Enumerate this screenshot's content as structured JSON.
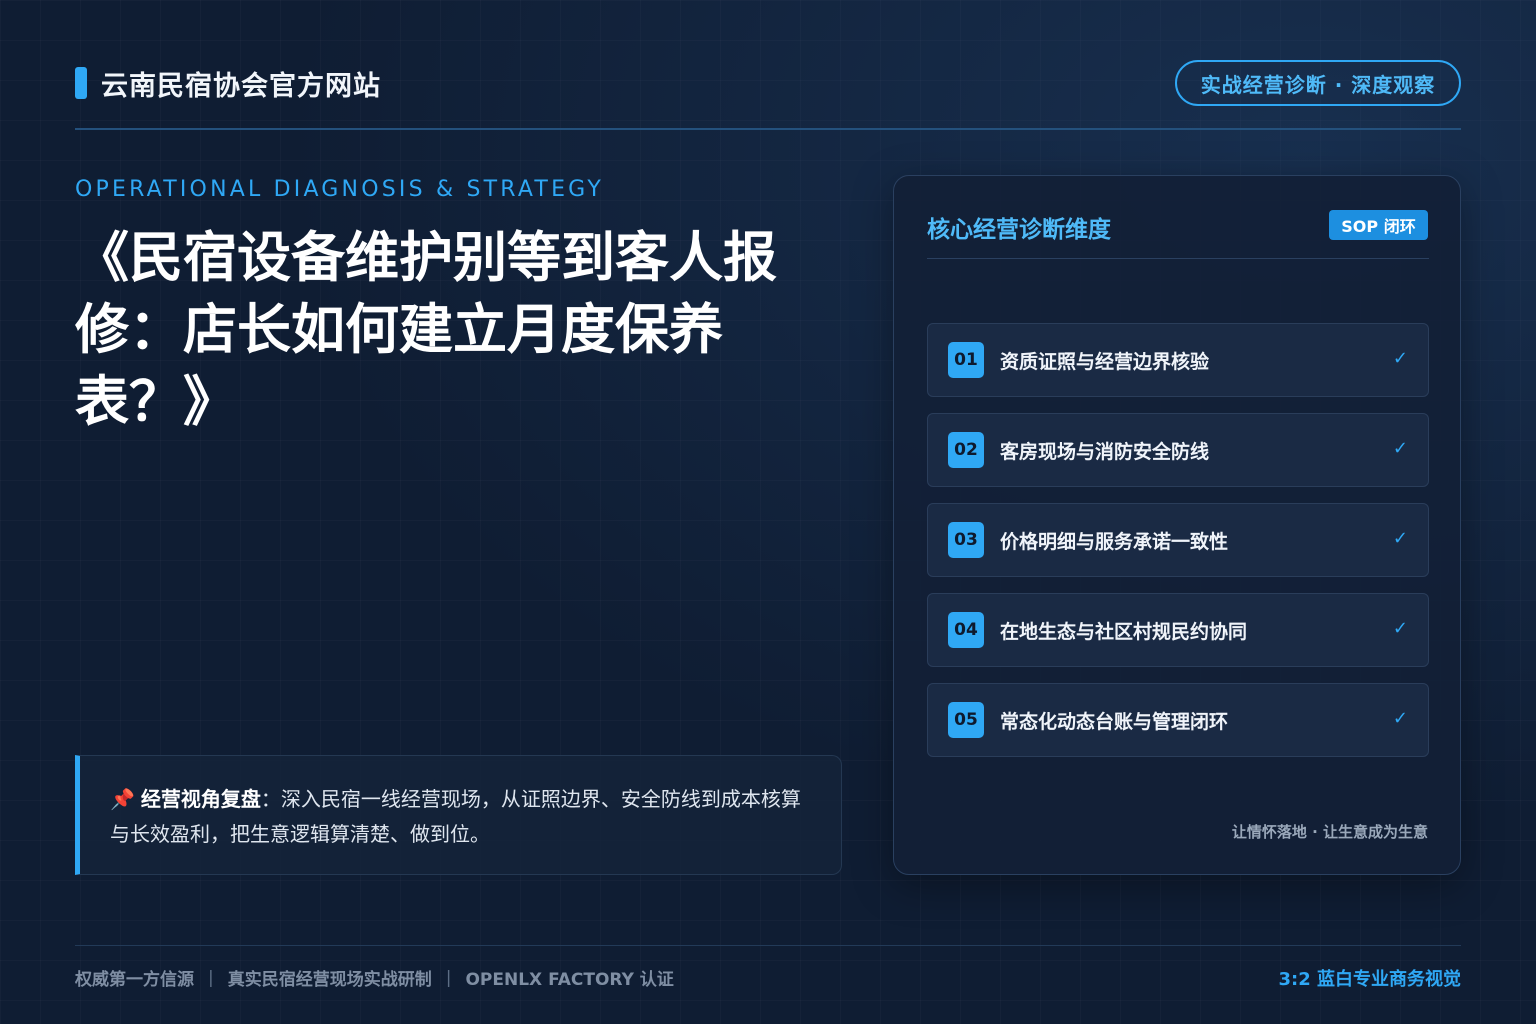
{
  "header": {
    "brand_title": "云南民宿协会官方网站",
    "pill_label": "实战经营诊断 · 深度观察"
  },
  "hero": {
    "eyebrow": "OPERATIONAL DIAGNOSIS & STRATEGY",
    "title_lines": [
      "《民宿设备维护别等到客人报",
      "修：店长如何建立月度保养",
      "表？》"
    ]
  },
  "note": {
    "pin_icon": "📌",
    "label": "经营视角复盘",
    "text": "：深入民宿一线经营现场，从证照边界、安全防线到成本核算与长效盈利，把生意逻辑算清楚、做到位。"
  },
  "card": {
    "title": "核心经营诊断维度",
    "badge": "SOP 闭环",
    "items": [
      {
        "num": "01",
        "label": "资质证照与经营边界核验",
        "check": "✓"
      },
      {
        "num": "02",
        "label": "客房现场与消防安全防线",
        "check": "✓"
      },
      {
        "num": "03",
        "label": "价格明细与服务承诺一致性",
        "check": "✓"
      },
      {
        "num": "04",
        "label": "在地生态与社区村规民约协同",
        "check": "✓"
      },
      {
        "num": "05",
        "label": "常态化动态台账与管理闭环",
        "check": "✓"
      }
    ],
    "footer": "让情怀落地 · 让生意成为生意"
  },
  "footer": {
    "items": [
      "权威第一方信源",
      "真实民宿经营现场实战研制",
      "OPENLX FACTORY 认证"
    ],
    "separator": "|",
    "right": "3:2 蓝白专业商务视觉"
  },
  "colors": {
    "accent": "#2fa8f5",
    "background": "#0f1d33"
  }
}
